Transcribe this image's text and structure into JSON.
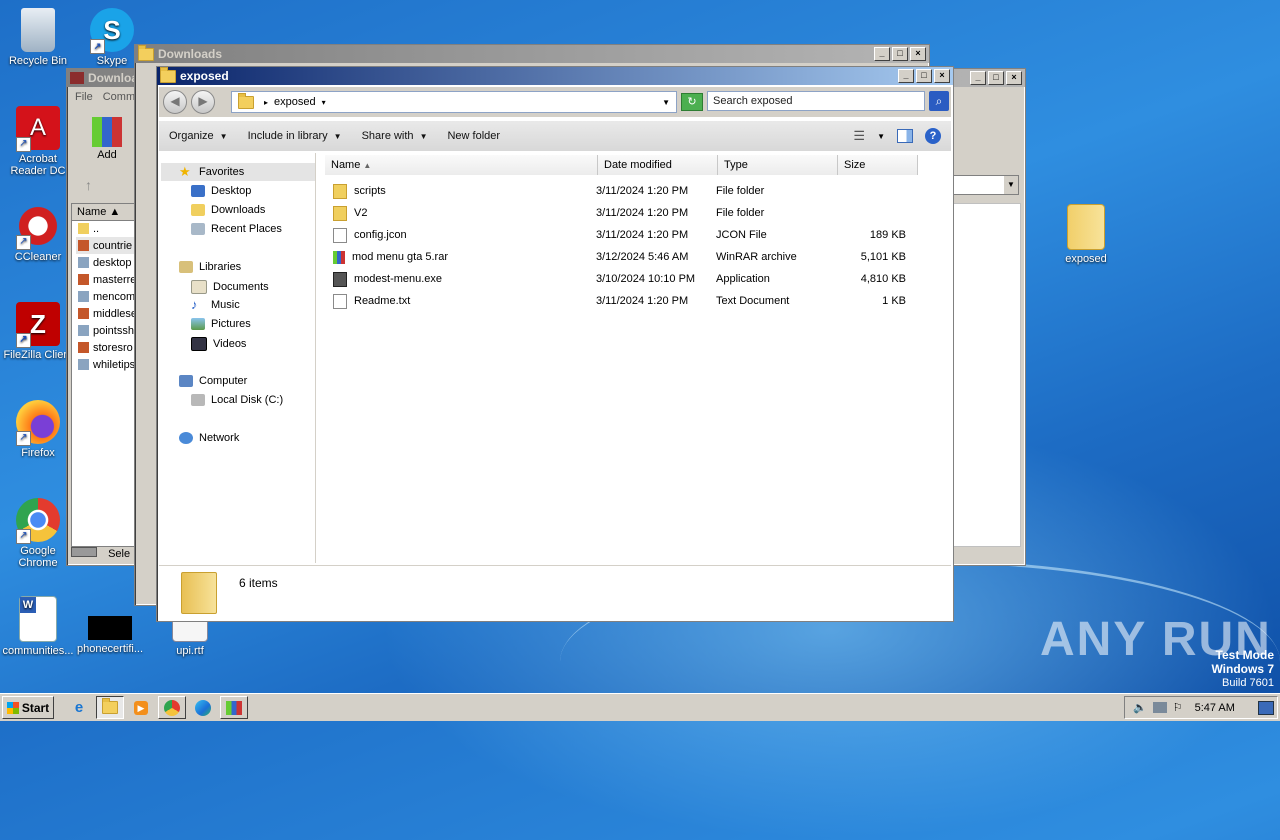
{
  "desktop": {
    "icons": [
      {
        "label": "Recycle Bin"
      },
      {
        "label": "Skype"
      },
      {
        "label": "Acrobat Reader DC"
      },
      {
        "label": "CCleaner"
      },
      {
        "label": "FileZilla Client"
      },
      {
        "label": "Firefox"
      },
      {
        "label": "Google Chrome"
      },
      {
        "label": "communities..."
      },
      {
        "label": "phonecertifi..."
      },
      {
        "label": "upi.rtf"
      },
      {
        "label": "exposed"
      }
    ],
    "watermark": "ANY RUN",
    "test_mode": [
      "Test Mode",
      "Windows 7",
      "Build 7601"
    ]
  },
  "winrar": {
    "title": "Downloa",
    "menu": [
      "File",
      "Comm"
    ],
    "add_label": "Add",
    "col_name": "Name",
    "files": [
      "..",
      "countrie",
      "desktop",
      "masterre",
      "mencom",
      "middlese",
      "pointssh",
      "storesro",
      "whiletips"
    ],
    "status": "Sele"
  },
  "downloads_window": {
    "title": "Downloads"
  },
  "explorer": {
    "title": "exposed",
    "address": "exposed",
    "search_placeholder": "Search exposed",
    "toolbar": {
      "organize": "Organize",
      "include": "Include in library",
      "share": "Share with",
      "new_folder": "New folder"
    },
    "nav": {
      "favorites": "Favorites",
      "desktop": "Desktop",
      "downloads": "Downloads",
      "recent": "Recent Places",
      "libraries": "Libraries",
      "documents": "Documents",
      "music": "Music",
      "pictures": "Pictures",
      "videos": "Videos",
      "computer": "Computer",
      "local_disk": "Local Disk (C:)",
      "network": "Network"
    },
    "columns": {
      "name": "Name",
      "date": "Date modified",
      "type": "Type",
      "size": "Size"
    },
    "files": [
      {
        "name": "scripts",
        "date": "3/11/2024 1:20 PM",
        "type": "File folder",
        "size": ""
      },
      {
        "name": "V2",
        "date": "3/11/2024 1:20 PM",
        "type": "File folder",
        "size": ""
      },
      {
        "name": "config.jcon",
        "date": "3/11/2024 1:20 PM",
        "type": "JCON File",
        "size": "189 KB"
      },
      {
        "name": "mod menu gta 5.rar",
        "date": "3/12/2024 5:46 AM",
        "type": "WinRAR archive",
        "size": "5,101 KB"
      },
      {
        "name": "modest-menu.exe",
        "date": "3/10/2024 10:10 PM",
        "type": "Application",
        "size": "4,810 KB"
      },
      {
        "name": "Readme.txt",
        "date": "3/11/2024 1:20 PM",
        "type": "Text Document",
        "size": "1 KB"
      }
    ],
    "details_count": "6 items"
  },
  "taskbar": {
    "start": "Start",
    "time": "5:47 AM"
  }
}
